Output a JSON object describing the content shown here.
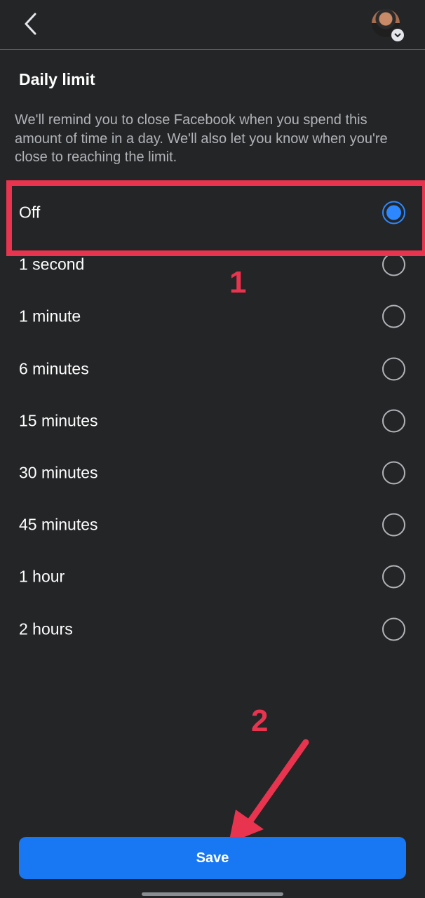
{
  "header": {
    "back_icon": "chevron-left-icon",
    "avatar_icon": "profile-avatar",
    "avatar_badge_icon": "chevron-down-icon"
  },
  "page": {
    "title": "Daily limit",
    "description": "We'll remind you to close Facebook when you spend this amount of time in a day. We'll also let you know when you're close to reaching the limit."
  },
  "options": [
    {
      "label": "Off",
      "selected": true
    },
    {
      "label": "1 second",
      "selected": false
    },
    {
      "label": "1 minute",
      "selected": false
    },
    {
      "label": "6 minutes",
      "selected": false
    },
    {
      "label": "15 minutes",
      "selected": false
    },
    {
      "label": "30 minutes",
      "selected": false
    },
    {
      "label": "45 minutes",
      "selected": false
    },
    {
      "label": "1 hour",
      "selected": false
    },
    {
      "label": "2 hours",
      "selected": false
    }
  ],
  "annotations": {
    "step1": "1",
    "step2": "2",
    "color": "#e8344e"
  },
  "footer": {
    "save_label": "Save"
  },
  "colors": {
    "background": "#242526",
    "accent": "#2d88ff",
    "button": "#1877f2"
  }
}
